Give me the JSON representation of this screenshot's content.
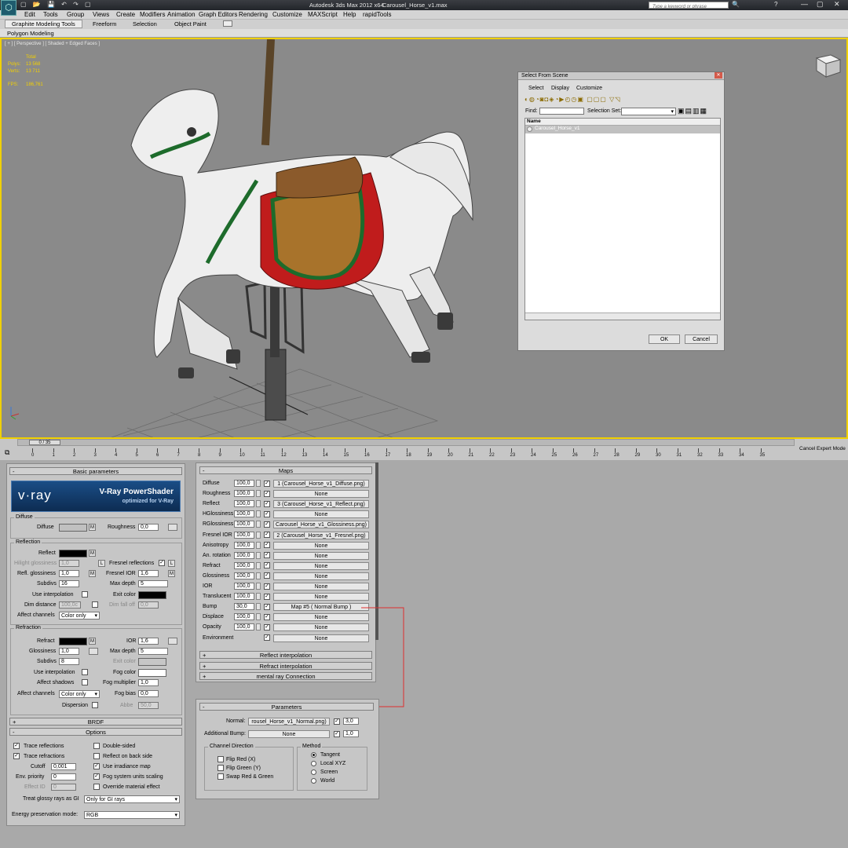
{
  "window": {
    "title": "Autodesk 3ds Max  2012 x64",
    "file": "Carousel_Horse_v1.max",
    "search_placeholder": "Type a keyword or phrase"
  },
  "menu": [
    "Edit",
    "Tools",
    "Group",
    "Views",
    "Create",
    "Modifiers",
    "Animation",
    "Graph Editors",
    "Rendering",
    "Customize",
    "MAXScript",
    "Help",
    "rapidTools"
  ],
  "ribbon": {
    "tabs": [
      "Graphite Modeling Tools",
      "Freeform",
      "Selection",
      "Object Paint"
    ],
    "sub": "Polygon Modeling"
  },
  "viewport": {
    "label": "[ + ] [ Perspective ] [ Shaded + Edged Faces ]",
    "stats": {
      "total": "Total",
      "polys_label": "Polys:",
      "polys": "13 568",
      "verts_label": "Verts:",
      "verts": "13 711",
      "fps_label": "FPS:",
      "fps": "186,761"
    }
  },
  "dialog": {
    "title": "Select From Scene",
    "menu": [
      "Select",
      "Display",
      "Customize"
    ],
    "find_label": "Find:",
    "selection_set": "Selection Set:",
    "col_name": "Name",
    "item": "Carousel_Horse_v1",
    "ok": "OK",
    "cancel": "Cancel"
  },
  "timeline": {
    "frame": "0 / 35",
    "ticks": [
      "0",
      "1",
      "2",
      "3",
      "4",
      "5",
      "6",
      "7",
      "8",
      "9",
      "10",
      "11",
      "12",
      "13",
      "14",
      "15",
      "16",
      "17",
      "18",
      "19",
      "20",
      "21",
      "22",
      "23",
      "24",
      "25",
      "26",
      "27",
      "28",
      "29",
      "30",
      "31",
      "32",
      "33",
      "34",
      "35"
    ],
    "cancel_expert": "Cancel Expert Mode"
  },
  "basic": {
    "header": "Basic parameters",
    "banner_brand": "v·ray",
    "banner_title": "V-Ray PowerShader",
    "banner_sub": "optimized for V-Ray",
    "diffuse_group": "Diffuse",
    "diffuse": "Diffuse",
    "roughness": "Roughness",
    "roughness_val": "0,0",
    "reflection_group": "Reflection",
    "reflect": "Reflect",
    "hilight": "Hilight glossiness",
    "hilight_val": "1,0",
    "fresnel": "Fresnel reflections",
    "refl_gloss": "Refl. glossiness",
    "refl_gloss_val": "1,0",
    "fresnel_ior": "Fresnel IOR",
    "fresnel_ior_val": "1,6",
    "subdivs": "Subdivs",
    "subdivs_val": "16",
    "max_depth": "Max depth",
    "max_depth_val": "5",
    "use_interp": "Use interpolation",
    "exit_color": "Exit color",
    "dim_distance": "Dim distance",
    "dim_distance_val": "100,0c",
    "dim_falloff": "Dim fall off",
    "dim_falloff_val": "0,0",
    "affect_channels": "Affect channels",
    "color_only": "Color only",
    "refraction_group": "Refraction",
    "refract": "Refract",
    "ior": "IOR",
    "ior_val": "1,6",
    "glossiness": "Glossiness",
    "glossiness_val": "1,0",
    "r_max_depth_val": "5",
    "r_subdivs_val": "8",
    "fog_color": "Fog color",
    "fog_mult": "Fog multiplier",
    "fog_mult_val": "1,0",
    "affect_shadows": "Affect shadows",
    "fog_bias": "Fog bias",
    "fog_bias_val": "0,0",
    "dispersion": "Dispersion",
    "abbe": "Abbe",
    "abbe_val": "50,0"
  },
  "brdf": "BRDF",
  "options": {
    "header": "Options",
    "trace_refl": "Trace reflections",
    "trace_refr": "Trace refractions",
    "double_sided": "Double-sided",
    "reflect_back": "Reflect on back side",
    "cutoff": "Cutoff",
    "cutoff_val": "0,001",
    "use_irr": "Use irradiance map",
    "env_priority": "Env. priority",
    "env_priority_val": "0",
    "fog_units": "Fog system units scaling",
    "effect_id": "Effect ID",
    "effect_id_val": "0",
    "override": "Override material effect",
    "glossy_gi": "Treat glossy rays as GI",
    "glossy_gi_val": "Only for GI rays",
    "energy": "Energy preservation mode:",
    "energy_val": "RGB"
  },
  "maps": {
    "header": "Maps",
    "rows": [
      {
        "name": "Diffuse",
        "amt": "100,0",
        "map": "1 (Carousel_Horse_v1_Diffuse.png)"
      },
      {
        "name": "Roughness",
        "amt": "100,0",
        "map": "None"
      },
      {
        "name": "Reflect",
        "amt": "100,0",
        "map": "3 (Carousel_Horse_v1_Reflect.png)"
      },
      {
        "name": "HGlossiness",
        "amt": "100,0",
        "map": "None"
      },
      {
        "name": "RGlossiness",
        "amt": "100,0",
        "map": "Carousel_Horse_v1_Glossiness.png)"
      },
      {
        "name": "Fresnel IOR",
        "amt": "100,0",
        "map": "2 (Carousel_Horse_v1_Fresnel.png)"
      },
      {
        "name": "Anisotropy",
        "amt": "100,0",
        "map": "None"
      },
      {
        "name": "An. rotation",
        "amt": "100,0",
        "map": "None"
      },
      {
        "name": "Refract",
        "amt": "100,0",
        "map": "None"
      },
      {
        "name": "Glossiness",
        "amt": "100,0",
        "map": "None"
      },
      {
        "name": "IOR",
        "amt": "100,0",
        "map": "None"
      },
      {
        "name": "Translucent",
        "amt": "100,0",
        "map": "None"
      },
      {
        "name": "Bump",
        "amt": "30,0",
        "map": "Map #5  ( Normal Bump )"
      },
      {
        "name": "Displace",
        "amt": "100,0",
        "map": "None"
      },
      {
        "name": "Opacity",
        "amt": "100,0",
        "map": "None"
      },
      {
        "name": "Environment",
        "amt": "",
        "map": "None"
      }
    ],
    "rollouts": [
      "Reflect interpolation",
      "Refract interpolation",
      "mental ray Connection"
    ]
  },
  "params": {
    "header": "Parameters",
    "normal": "Normal:",
    "normal_map": "rousel_Horse_v1_Normal.png)",
    "normal_val": "3,0",
    "add_bump": "Additional Bump:",
    "add_bump_map": "None",
    "add_bump_val": "1,0",
    "channel_dir": "Channel Direction",
    "flip_red": "Flip Red (X)",
    "flip_green": "Flip Green (Y)",
    "swap": "Swap Red & Green",
    "method": "Method",
    "tangent": "Tangent",
    "local": "Local XYZ",
    "screen": "Screen",
    "world": "World"
  }
}
